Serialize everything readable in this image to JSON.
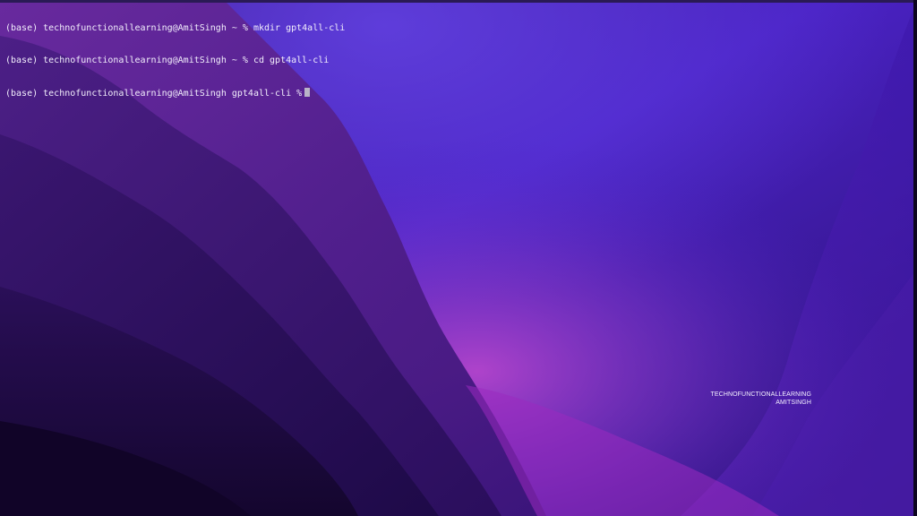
{
  "terminal": {
    "lines": [
      {
        "prompt": "(base) technofunctionallearning@AmitSingh ~ %",
        "command": "mkdir gpt4all-cli"
      },
      {
        "prompt": "(base) technofunctionallearning@AmitSingh ~ %",
        "command": "cd gpt4all-cli"
      },
      {
        "prompt": "(base) technofunctionallearning@AmitSingh gpt4all-cli %",
        "command": ""
      }
    ]
  },
  "watermark": {
    "line1": "TECHNOFUNCTIONALLEARNING",
    "line2": "AMITSINGH"
  },
  "colors": {
    "background": "#1a0838",
    "text": "#f2eefc",
    "cursor": "#b9b4c8",
    "accent_violet": "#5a2bd4",
    "accent_magenta": "#a02ab8"
  }
}
